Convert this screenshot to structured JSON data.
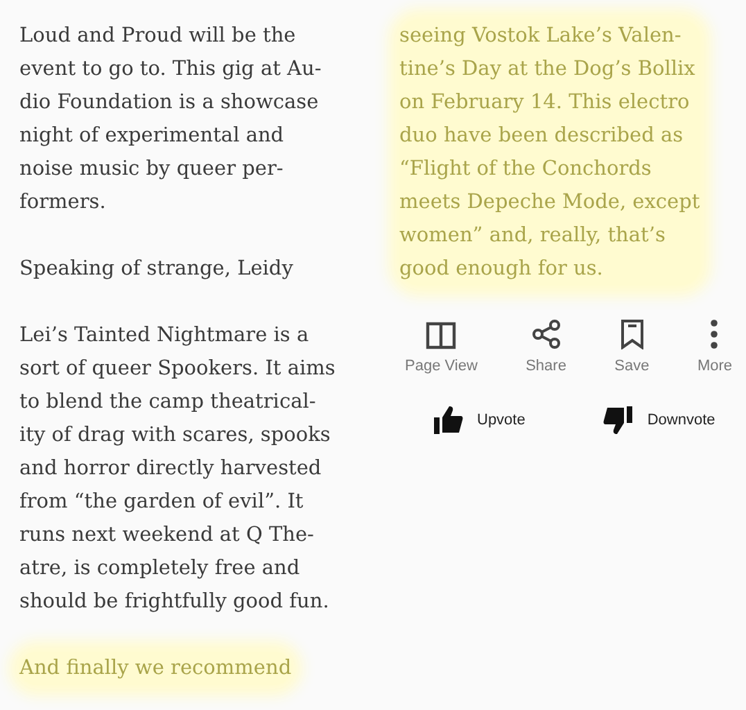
{
  "columns": [
    {
      "paragraphs": [
        {
          "highlighted": false,
          "lines": [
            "Loud and Proud will be the",
            "event to go to. This gig at Au-",
            "dio Foundation is a showcase",
            "night of experimental and",
            "noise music by queer per-",
            "formers."
          ]
        },
        {
          "highlighted": false,
          "lines": [
            "Speaking of strange, Leidy"
          ]
        },
        {
          "highlighted": false,
          "lines": [
            "Lei’s Tainted Nightmare is a",
            "sort of queer Spookers. It aims",
            "to blend the camp theatrical-",
            "ity of drag with scares, spooks",
            "and horror directly harvested",
            "from “the garden of evil”. It",
            "runs next weekend at Q The-",
            "atre, is completely free and",
            "should be frightfully good fun."
          ]
        },
        {
          "highlighted": true,
          "lines": [
            "And finally we recommend"
          ]
        }
      ]
    },
    {
      "paragraphs": [
        {
          "highlighted": true,
          "lines": [
            "seeing Vostok Lake’s Valen-",
            "tine’s Day at the Dog’s Bollix",
            "on February 14. This electro",
            "duo have been described as",
            "“Flight of the Conchords",
            "meets Depeche Mode, except",
            "women” and, really, that’s",
            "good enough for us."
          ]
        }
      ]
    }
  ],
  "actions": [
    {
      "kind": "page_view",
      "label": "Page View"
    },
    {
      "kind": "share",
      "label": "Share"
    },
    {
      "kind": "save",
      "label": "Save"
    },
    {
      "kind": "more",
      "label": "More"
    }
  ],
  "votes": [
    {
      "kind": "up",
      "label": "Upvote"
    },
    {
      "kind": "down",
      "label": "Downvote"
    }
  ]
}
